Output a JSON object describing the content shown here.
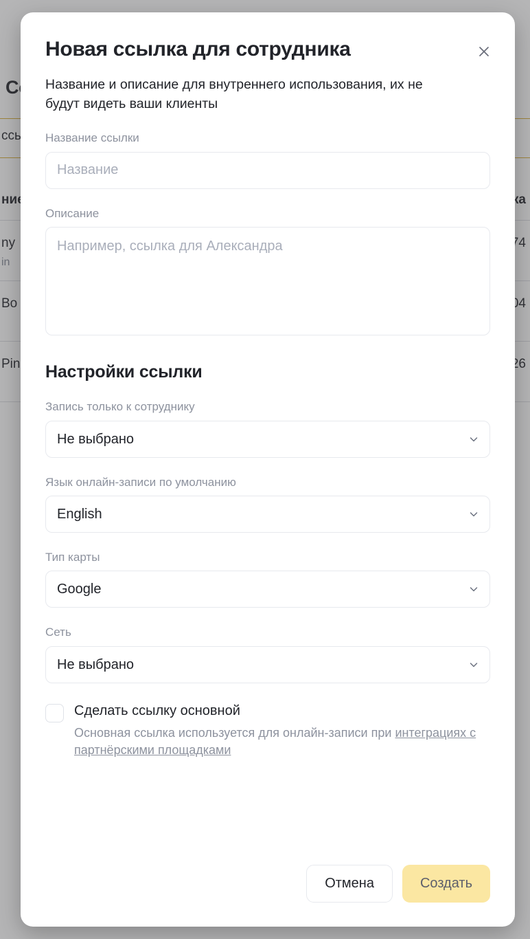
{
  "background": {
    "page_title": "Со",
    "tab_label": "ссь",
    "table": {
      "header_left": "ние",
      "header_right": "ка",
      "rows": [
        {
          "main": "ny",
          "sub": "in",
          "right": "74"
        },
        {
          "main": "Bo",
          "sub": "",
          "right": "04"
        },
        {
          "main": "Pin",
          "sub": "",
          "right": "26"
        }
      ]
    }
  },
  "modal": {
    "title": "Новая ссылка для сотрудника",
    "subtitle": "Название и описание для внутреннего использования, их не будут видеть ваши клиенты",
    "close_icon": "close-icon",
    "fields": {
      "name": {
        "label": "Название ссылки",
        "placeholder": "Название",
        "value": ""
      },
      "description": {
        "label": "Описание",
        "placeholder": "Например, ссылка для Александра",
        "value": ""
      }
    },
    "settings": {
      "heading": "Настройки ссылки",
      "selects": [
        {
          "label": "Запись только к сотруднику",
          "value": "Не выбрано",
          "icon": "chevron-down-icon"
        },
        {
          "label": "Язык онлайн-записи по умолчанию",
          "value": "English",
          "icon": "chevron-down-icon"
        },
        {
          "label": "Тип карты",
          "value": "Google",
          "icon": "chevron-down-icon"
        },
        {
          "label": "Сеть",
          "value": "Не выбрано",
          "icon": "chevron-down-icon"
        }
      ]
    },
    "main_link": {
      "checkbox_label": "Сделать ссылку основной",
      "hint_text": "Основная ссылка используется для онлайн-записи при ",
      "hint_link": "интеграциях с партнёрскими площадками",
      "checked": false
    },
    "footer": {
      "cancel_label": "Отмена",
      "create_label": "Создать"
    }
  },
  "colors": {
    "accent_yellow": "#FBE7A2",
    "create_text": "#5C5F6B",
    "text_primary": "#22242A",
    "text_muted": "#8D929E",
    "border": "#E7E9EE",
    "placeholder": "#A9AEBA",
    "tab_underline": "#D8AE3A"
  }
}
